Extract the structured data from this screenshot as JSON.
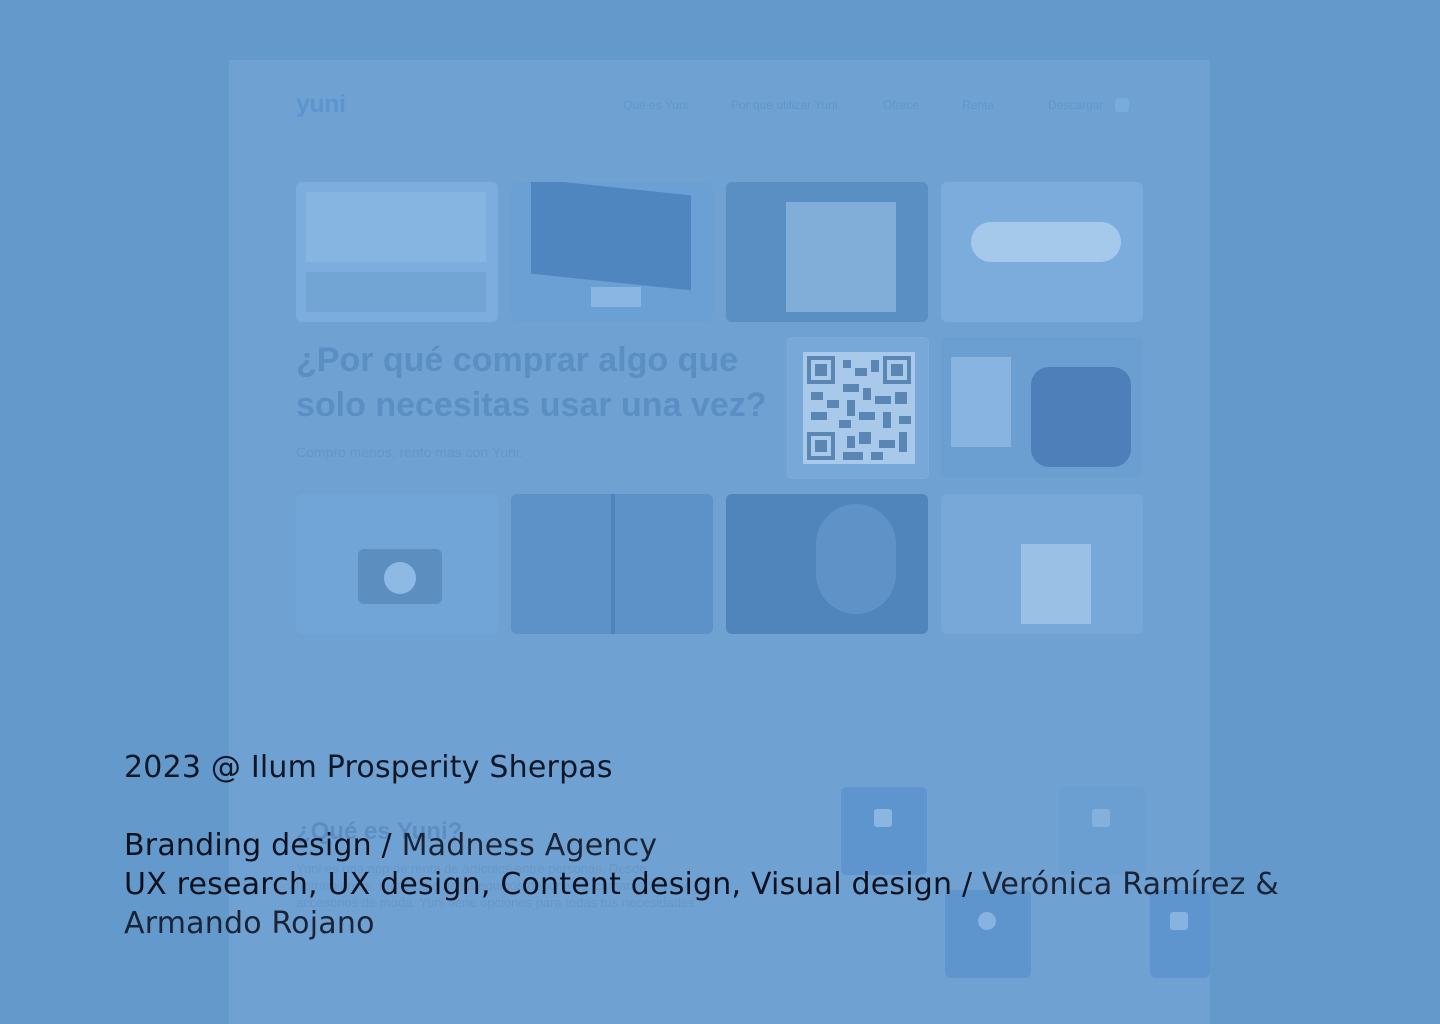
{
  "colors": {
    "background": "#6499cb",
    "mockup": "#6fa2d3",
    "credit_text": "#101828"
  },
  "mockup": {
    "logo": "yuni",
    "nav": [
      "Qué es Yuni",
      "Por qué utilizar Yuni",
      "Ofrece",
      "Renta",
      "Descargar"
    ],
    "hero_title": "¿Por qué comprar algo que solo necesitas usar una vez?",
    "hero_subtitle": "Compro menos, rento más con Yuni.",
    "section2_title": "¿Qué es Yuni?",
    "section2_body": "Yuni es una app de renta de artículos entre personas. Desde herramientas, tecnología hasta equipos deportivos, cámaras, ropa y accesorios de moda. Yuni tiene opciones para todas tus necesidades"
  },
  "credits": {
    "line1": "2023 @ Ilum Prosperity Sherpas",
    "branding_role": "Branding design / ",
    "branding_name": "Madness Agency",
    "ux_role": "UX research, UX design, Content design, Visual design / ",
    "ux_name": "Verónica Ramírez & Armando Rojano"
  }
}
